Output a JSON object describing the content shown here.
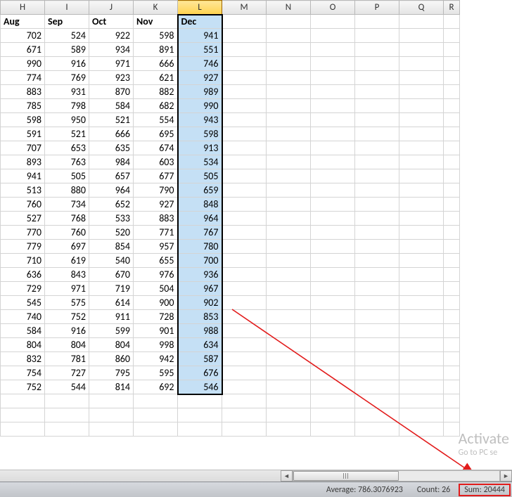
{
  "columns": [
    {
      "letter": "H",
      "label": "Aug"
    },
    {
      "letter": "I",
      "label": "Sep"
    },
    {
      "letter": "J",
      "label": "Oct"
    },
    {
      "letter": "K",
      "label": "Nov"
    },
    {
      "letter": "L",
      "label": "Dec"
    },
    {
      "letter": "M",
      "label": ""
    },
    {
      "letter": "N",
      "label": ""
    },
    {
      "letter": "O",
      "label": ""
    },
    {
      "letter": "P",
      "label": ""
    },
    {
      "letter": "Q",
      "label": ""
    },
    {
      "letter": "R",
      "label": ""
    }
  ],
  "active_column": "L",
  "rows": [
    [
      702,
      524,
      922,
      598,
      941
    ],
    [
      671,
      589,
      934,
      891,
      551
    ],
    [
      990,
      916,
      971,
      666,
      746
    ],
    [
      774,
      769,
      923,
      621,
      927
    ],
    [
      883,
      931,
      870,
      882,
      989
    ],
    [
      785,
      798,
      584,
      682,
      990
    ],
    [
      598,
      950,
      521,
      554,
      943
    ],
    [
      591,
      521,
      666,
      695,
      598
    ],
    [
      707,
      653,
      635,
      674,
      913
    ],
    [
      893,
      763,
      984,
      603,
      534
    ],
    [
      941,
      505,
      657,
      677,
      505
    ],
    [
      513,
      880,
      964,
      790,
      659
    ],
    [
      760,
      734,
      652,
      927,
      848
    ],
    [
      527,
      768,
      533,
      883,
      964
    ],
    [
      770,
      760,
      520,
      771,
      767
    ],
    [
      779,
      697,
      854,
      957,
      780
    ],
    [
      710,
      619,
      540,
      655,
      700
    ],
    [
      636,
      843,
      670,
      976,
      936
    ],
    [
      729,
      971,
      719,
      504,
      967
    ],
    [
      545,
      575,
      614,
      900,
      902
    ],
    [
      740,
      752,
      911,
      728,
      853
    ],
    [
      584,
      916,
      599,
      901,
      988
    ],
    [
      804,
      804,
      804,
      998,
      634
    ],
    [
      832,
      781,
      860,
      942,
      587
    ],
    [
      754,
      727,
      795,
      595,
      676
    ],
    [
      752,
      544,
      814,
      692,
      546
    ]
  ],
  "status": {
    "average_label": "Average:",
    "average_value": "786.3076923",
    "count_label": "Count:",
    "count_value": "26",
    "sum_label": "Sum:",
    "sum_value": "20444"
  },
  "watermark": {
    "line1": "Activate",
    "line2": "Go to PC se"
  },
  "chart_data": {
    "type": "table",
    "columns": [
      "Aug",
      "Sep",
      "Oct",
      "Nov",
      "Dec"
    ],
    "values": [
      [
        702,
        524,
        922,
        598,
        941
      ],
      [
        671,
        589,
        934,
        891,
        551
      ],
      [
        990,
        916,
        971,
        666,
        746
      ],
      [
        774,
        769,
        923,
        621,
        927
      ],
      [
        883,
        931,
        870,
        882,
        989
      ],
      [
        785,
        798,
        584,
        682,
        990
      ],
      [
        598,
        950,
        521,
        554,
        943
      ],
      [
        591,
        521,
        666,
        695,
        598
      ],
      [
        707,
        653,
        635,
        674,
        913
      ],
      [
        893,
        763,
        984,
        603,
        534
      ],
      [
        941,
        505,
        657,
        677,
        505
      ],
      [
        513,
        880,
        964,
        790,
        659
      ],
      [
        760,
        734,
        652,
        927,
        848
      ],
      [
        527,
        768,
        533,
        883,
        964
      ],
      [
        770,
        760,
        520,
        771,
        767
      ],
      [
        779,
        697,
        854,
        957,
        780
      ],
      [
        710,
        619,
        540,
        655,
        700
      ],
      [
        636,
        843,
        670,
        976,
        936
      ],
      [
        729,
        971,
        719,
        504,
        967
      ],
      [
        545,
        575,
        614,
        900,
        902
      ],
      [
        740,
        752,
        911,
        728,
        853
      ],
      [
        584,
        916,
        599,
        901,
        988
      ],
      [
        804,
        804,
        804,
        998,
        634
      ],
      [
        832,
        781,
        860,
        942,
        587
      ],
      [
        754,
        727,
        795,
        595,
        676
      ],
      [
        752,
        544,
        814,
        692,
        546
      ]
    ],
    "selected_column": "Dec",
    "aggregates": {
      "average": 786.3076923,
      "count": 26,
      "sum": 20444
    }
  }
}
